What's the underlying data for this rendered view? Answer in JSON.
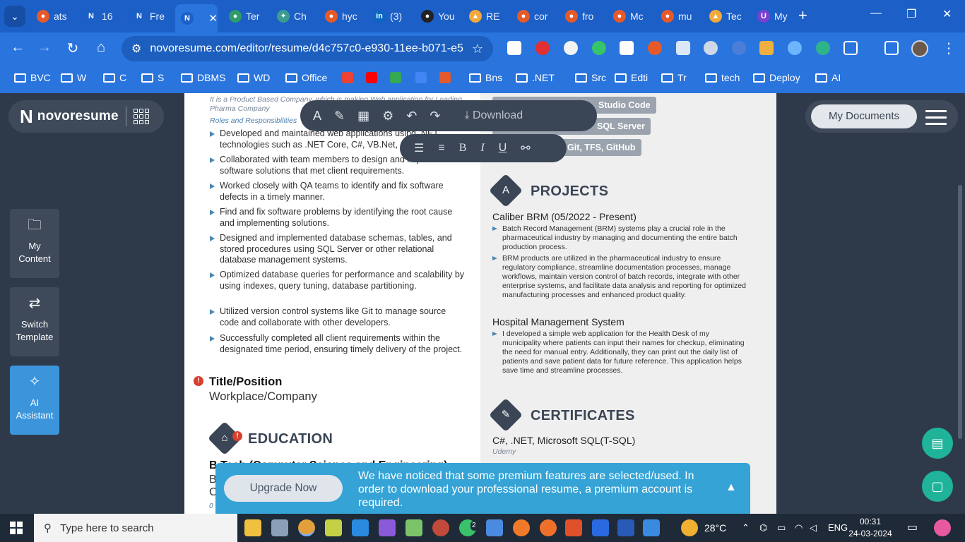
{
  "browser": {
    "tabs": [
      {
        "label": "ats",
        "fav_color": "#e55a2b",
        "fav_glyph": "●"
      },
      {
        "label": "16",
        "fav_color": "#1b5fc7",
        "fav_glyph": "N"
      },
      {
        "label": "Fre",
        "fav_color": "#1b5fc7",
        "fav_glyph": "N"
      },
      {
        "label": "",
        "fav_color": "#1b5fc7",
        "fav_glyph": "N"
      },
      {
        "label": "Ter",
        "fav_color": "#2e9c6b",
        "fav_glyph": "●"
      },
      {
        "label": "Ch",
        "fav_color": "#3a9d8f",
        "fav_glyph": "✦"
      },
      {
        "label": "hyc",
        "fav_color": "#e55a2b",
        "fav_glyph": "●"
      },
      {
        "label": "(3)",
        "fav_color": "#0a66c2",
        "fav_glyph": "in"
      },
      {
        "label": "You",
        "fav_color": "#222222",
        "fav_glyph": "●"
      },
      {
        "label": "RE",
        "fav_color": "#f2a93b",
        "fav_glyph": "▲"
      },
      {
        "label": "cor",
        "fav_color": "#e55a2b",
        "fav_glyph": "●"
      },
      {
        "label": "fro",
        "fav_color": "#e55a2b",
        "fav_glyph": "●"
      },
      {
        "label": "Mc",
        "fav_color": "#e55a2b",
        "fav_glyph": "●"
      },
      {
        "label": "mu",
        "fav_color": "#e55a2b",
        "fav_glyph": "●"
      },
      {
        "label": "Tec",
        "fav_color": "#f2a93b",
        "fav_glyph": "▲"
      },
      {
        "label": "My",
        "fav_color": "#7b3fd1",
        "fav_glyph": "U"
      }
    ],
    "tab_close_glyph": "✕",
    "new_tab_glyph": "+",
    "window_controls": {
      "minimize": "—",
      "maximize": "❐",
      "close": "✕"
    },
    "url": "novoresume.com/editor/resume/d4c757c0-e930-11ee-b071-e5...",
    "bookmarks": [
      {
        "label": "BVC",
        "kind": "folder"
      },
      {
        "label": "W",
        "kind": "folder"
      },
      {
        "label": "C",
        "kind": "folder"
      },
      {
        "label": "S",
        "kind": "folder"
      },
      {
        "label": "DBMS",
        "kind": "folder"
      },
      {
        "label": "WD",
        "kind": "folder"
      },
      {
        "label": "Office",
        "kind": "folder"
      },
      {
        "label": "",
        "kind": "site",
        "color": "#ea4335"
      },
      {
        "label": "",
        "kind": "site",
        "color": "#ff0000"
      },
      {
        "label": "",
        "kind": "site",
        "color": "#34a853"
      },
      {
        "label": "",
        "kind": "site",
        "color": "#4285f4"
      },
      {
        "label": "",
        "kind": "site",
        "color": "#e55a2b"
      },
      {
        "label": "Bns",
        "kind": "folder"
      },
      {
        "label": ".NET",
        "kind": "folder"
      },
      {
        "label": "Src",
        "kind": "folder"
      },
      {
        "label": "Edti",
        "kind": "folder"
      },
      {
        "label": "Tr",
        "kind": "folder"
      },
      {
        "label": "tech",
        "kind": "folder"
      },
      {
        "label": "Deploy",
        "kind": "folder"
      },
      {
        "label": "AI",
        "kind": "folder"
      }
    ]
  },
  "app": {
    "brand": "novoresume",
    "my_documents": "My Documents",
    "side_buttons": [
      {
        "label_1": "My",
        "label_2": "Content",
        "icon": "folder-icon"
      },
      {
        "label_1": "Switch",
        "label_2": "Template",
        "icon": "switch-icon"
      },
      {
        "label_1": "AI",
        "label_2": "Assistant",
        "icon": "ai-icon"
      }
    ],
    "toolbar": {
      "download": "Download"
    },
    "resume": {
      "company_note": "It is a Product Based Company, which is making Web application for Leading Pharma Company",
      "roles_label": "Roles and Responsibilities",
      "bullets": [
        "Developed and maintained web applications using .NET technologies such as .NET Core, C#, VB.Net, a",
        "Collaborated with team members to design and implement software solutions that met client requirements.",
        "Worked closely with QA teams to identify and fix software defects in a timely manner.",
        "Find and fix software problems by identifying the root cause and implementing solutions.",
        "Designed and implemented database schemas, tables, and stored procedures using SQL Server or other relational database management systems.",
        "Optimized database queries for performance and scalability by using indexes, query tuning, database partitioning.",
        "Utilized version control systems like Git to manage source code and collaborate with other developers.",
        "Successfully completed all client requirements within the designated time period, ensuring timely delivery of the project."
      ],
      "title_position": "Title/Position",
      "workplace": "Workplace/Company",
      "education_heading": "EDUCATION",
      "education_degree": "B.Tech (Computer Science and Engineering)",
      "education_line2": "B",
      "education_line3": "C",
      "education_date": "0",
      "skill_tags": [
        "Studio Code",
        "SQL Server",
        "Git, TFS, GitHub"
      ],
      "projects_heading": "PROJECTS",
      "projects": [
        {
          "title": "Caliber BRM (05/2022 - Present)",
          "bullets": [
            "Batch Record Management (BRM) systems play a crucial role in the pharmaceutical industry by managing and documenting the entire batch production process.",
            "BRM products are utilized in the pharmaceutical industry to ensure regulatory compliance, streamline documentation processes, manage workflows, maintain version control of batch records, integrate with other enterprise systems, and facilitate data analysis and reporting for optimized manufacturing processes and enhanced product quality."
          ]
        },
        {
          "title": "Hospital Management System",
          "bullets": [
            "I developed a simple web application for the Health Desk of my municipality where patients can input their names for checkup, eliminating the need for manual entry. Additionally, they can print out the daily list of patients and save patient data for future reference. This application helps save time and streamline processes."
          ]
        }
      ],
      "certificates_heading": "CERTIFICATES",
      "certificate_title": "C#, .NET, Microsoft SQL(T-SQL)",
      "certificate_issuer": "Udemy"
    },
    "premium": {
      "upgrade": "Upgrade Now",
      "message": "We have noticed that some premium features are selected/used. In order to download your professional resume, a premium account is required.",
      "collapse_glyph": "▲"
    }
  },
  "taskbar": {
    "search_placeholder": "Type here to search",
    "weather": "28°C",
    "language": "ENG",
    "time": "00:31",
    "date": "24-03-2024",
    "whatsapp_badge": "2"
  }
}
